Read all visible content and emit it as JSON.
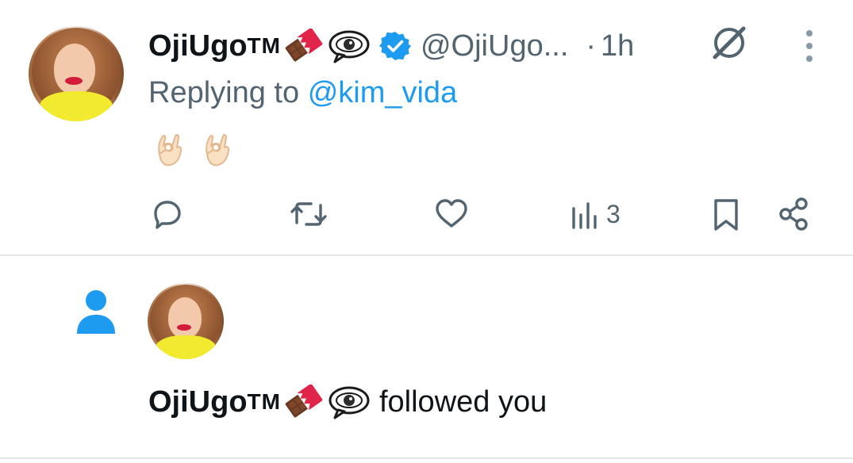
{
  "tweet": {
    "display_name": "OjiUgo",
    "trademark": "TM",
    "name_emojis": [
      "chocolate-bar",
      "eye-in-speech-bubble"
    ],
    "verified": true,
    "handle": "@OjiUgo...",
    "separator": "·",
    "time": "1h",
    "replying_prefix": "Replying to",
    "replying_mention": "@kim_vida",
    "body_emojis": [
      "ok-hand",
      "ok-hand"
    ],
    "actions": {
      "reply_icon": "reply-icon",
      "retweet_icon": "retweet-icon",
      "like_icon": "heart-icon",
      "views_icon": "views-chart-icon",
      "views_count": "3",
      "bookmark_icon": "bookmark-icon",
      "share_icon": "share-icon"
    }
  },
  "notification": {
    "icon": "person-icon",
    "display_name": "OjiUgo",
    "trademark": "TM",
    "message": "followed you"
  },
  "colors": {
    "accent": "#1d9bf0",
    "secondary_text": "#536471",
    "primary_text": "#0f1419",
    "divider": "#e3e6e8"
  }
}
